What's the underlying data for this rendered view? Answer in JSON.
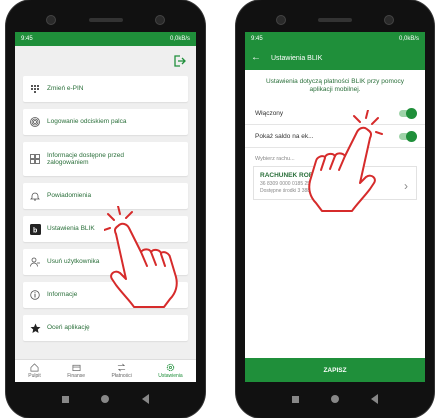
{
  "left_phone": {
    "status": {
      "time": "9:45",
      "network": "0,0kB/s"
    },
    "menu": [
      {
        "label": "Zmień e-PIN",
        "icon": "keypad-icon"
      },
      {
        "label": "Logowanie odciskiem palca",
        "icon": "fingerprint-icon"
      },
      {
        "label": "Informacje dostępne przed zalogowaniem",
        "icon": "grid-icon"
      },
      {
        "label": "Powiadomienia",
        "icon": "bell-icon"
      },
      {
        "label": "Ustawienia BLIK",
        "icon": "blik-icon"
      },
      {
        "label": "Usuń użytkownika",
        "icon": "user-remove-icon"
      },
      {
        "label": "Informacje",
        "icon": "info-icon"
      },
      {
        "label": "Oceń aplikację",
        "icon": "star-icon"
      }
    ],
    "bottom_nav": [
      {
        "label": "Pulpit",
        "icon": "home-icon",
        "active": false
      },
      {
        "label": "Finanse",
        "icon": "wallet-icon",
        "active": false
      },
      {
        "label": "Płatności",
        "icon": "transfer-icon",
        "active": false
      },
      {
        "label": "Ustawienia",
        "icon": "gear-icon",
        "active": true
      }
    ]
  },
  "right_phone": {
    "status": {
      "time": "9:45",
      "network": "0,0kB/s"
    },
    "title": "Ustawienia BLIK",
    "description": "Ustawienia dotyczą płatności BLIK przy pomocy aplikacji mobilnej.",
    "settings": [
      {
        "label": "Włączony",
        "on": true
      },
      {
        "label": "Pokaż saldo na ek...",
        "on": true
      }
    ],
    "choose_account_label": "Wybierz rachu...",
    "account": {
      "name": "RACHUNEK ROR",
      "number": "36 8309 0000 0185 2500 8000 0010",
      "available": "Dostępne środki 3 388,51 PLN"
    },
    "save_label": "ZAPISZ"
  },
  "colors": {
    "brand_green": "#1f8f3a",
    "hand_red": "#d62b2b"
  }
}
